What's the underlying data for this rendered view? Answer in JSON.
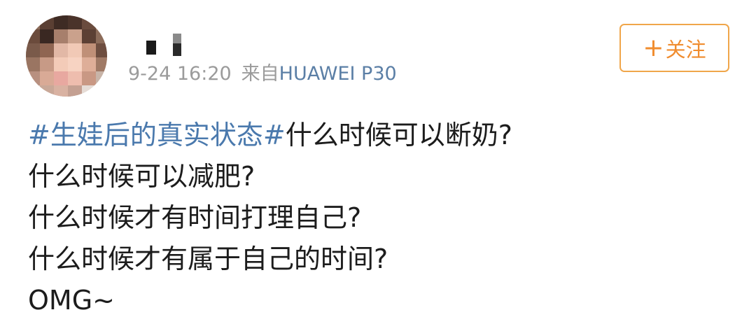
{
  "user": {
    "timestamp": "9-24 16:20",
    "source_prefix": "来自",
    "device": "HUAWEI P30"
  },
  "follow_button": {
    "plus": "+",
    "label": "关注"
  },
  "post": {
    "hashtag": "#生娃后的真实状态#",
    "line1_rest": "什么时候可以断奶?",
    "line2": "什么时候可以减肥?",
    "line3": "什么时候才有时间打理自己?",
    "line4": "什么时候才有属于自己的时间?",
    "line5": "OMG~"
  },
  "colors": {
    "hashtag": "#4a79ad",
    "follow_border": "#f0a64a",
    "follow_text": "#f08c2e",
    "meta_text": "#9b9b9b",
    "device_link": "#5b7fa6"
  }
}
